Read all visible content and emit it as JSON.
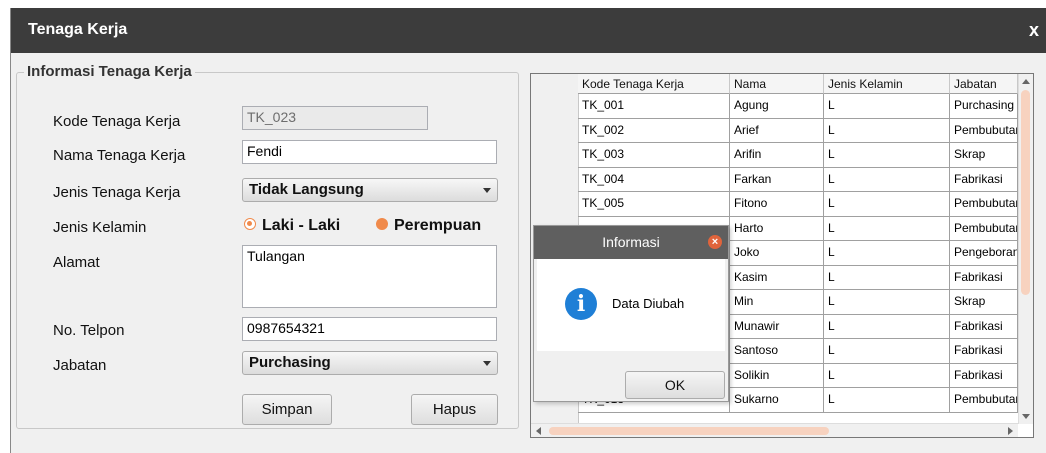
{
  "window": {
    "title": "Tenaga Kerja",
    "close_label": "x"
  },
  "form": {
    "group_title": "Informasi Tenaga Kerja",
    "kode_label": "Kode Tenaga Kerja",
    "kode_value": "TK_023",
    "nama_label": "Nama Tenaga Kerja",
    "nama_value": "Fendi",
    "jenis_label": "Jenis Tenaga Kerja",
    "jenis_value": "Tidak Langsung",
    "kelamin_label": "Jenis Kelamin",
    "kelamin_options": [
      "Laki - Laki",
      "Perempuan"
    ],
    "kelamin_selected": "Laki - Laki",
    "alamat_label": "Alamat",
    "alamat_value": "Tulangan",
    "telpon_label": "No. Telpon",
    "telpon_value": "0987654321",
    "jabatan_label": "Jabatan",
    "jabatan_value": "Purchasing",
    "simpan_label": "Simpan",
    "hapus_label": "Hapus"
  },
  "table": {
    "headers": [
      "Kode Tenaga Kerja",
      "Nama",
      "Jenis Kelamin",
      "Jabatan"
    ],
    "rows": [
      [
        "TK_001",
        "Agung",
        "L",
        "Purchasing"
      ],
      [
        "TK_002",
        "Arief",
        "L",
        "Pembubutan"
      ],
      [
        "TK_003",
        "Arifin",
        "L",
        "Skrap"
      ],
      [
        "TK_004",
        "Farkan",
        "L",
        "Fabrikasi"
      ],
      [
        "TK_005",
        "Fitono",
        "L",
        "Pembubutan"
      ],
      [
        "",
        "Harto",
        "L",
        "Pembubutan"
      ],
      [
        "",
        "Joko",
        "L",
        "Pengeboran"
      ],
      [
        "",
        "Kasim",
        "L",
        "Fabrikasi"
      ],
      [
        "",
        "Min",
        "L",
        "Skrap"
      ],
      [
        "",
        "Munawir",
        "L",
        "Fabrikasi"
      ],
      [
        "",
        "Santoso",
        "L",
        "Fabrikasi"
      ],
      [
        "",
        "Solikin",
        "L",
        "Fabrikasi"
      ],
      [
        "TK_013",
        "Sukarno",
        "L",
        "Pembubutan"
      ]
    ]
  },
  "dialog": {
    "title": "Informasi",
    "message": "Data Diubah",
    "ok_label": "OK"
  },
  "colors": {
    "titlebar": "#3c3c3c",
    "accent": "#f08a4b",
    "info": "#1f7fd6"
  }
}
